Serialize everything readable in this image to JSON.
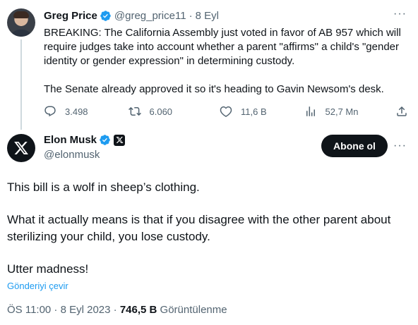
{
  "parent_tweet": {
    "author_name": "Greg Price",
    "handle": "@greg_price11",
    "separator": "·",
    "date": "8 Eyl",
    "more": "···",
    "paragraphs": [
      "BREAKING: The California Assembly just voted in favor of AB 957 which will require judges take into account whether a parent \"affirms\" a child's \"gender identity or gender expression\" in determining custody.",
      "The Senate already approved it so it's heading to Gavin Newsom's desk."
    ],
    "stats": {
      "replies": "3.498",
      "retweets": "6.060",
      "likes": "11,6 B",
      "views": "52,7 Mn"
    }
  },
  "main_tweet": {
    "author_name": "Elon Musk",
    "handle": "@elonmusk",
    "follow_label": "Abone ol",
    "more": "···",
    "paragraphs": [
      "This bill is a wolf in sheep’s clothing.",
      "What it actually means is that if you disagree with the other parent about sterilizing your child, you lose custody.",
      "Utter madness!"
    ],
    "translate_label": "Gönderiyi çevir",
    "timestamp": "ÖS 11:00 · 8 Eyl 2023",
    "meta_separator": " · ",
    "views_count": "746,5 B",
    "views_label": " Görüntülenme"
  },
  "colors": {
    "verified": "#1d9bf0",
    "link": "#1d9bf0",
    "secondary_text": "#536471",
    "primary_text": "#0f1419"
  },
  "icons": [
    "verified-badge-icon",
    "reply-icon",
    "retweet-icon",
    "like-icon",
    "views-icon",
    "share-icon",
    "x-logo-icon",
    "more-icon"
  ]
}
